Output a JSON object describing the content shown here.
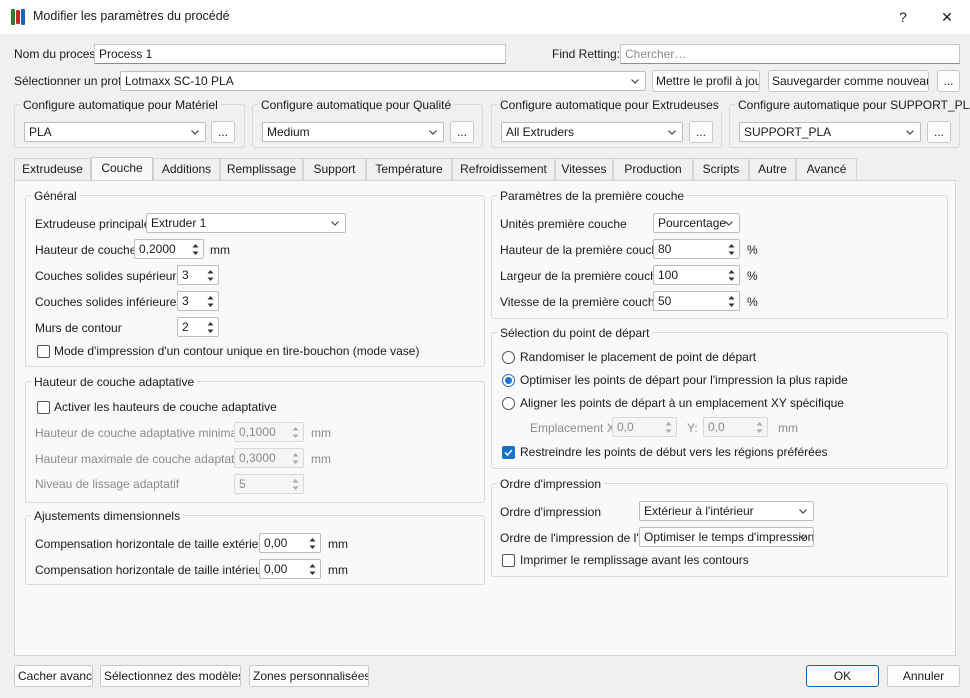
{
  "window": {
    "title": "Modifier les paramètres du procédé",
    "help_label": "?",
    "close_label": "✕"
  },
  "process_name": {
    "label": "Nom du process",
    "value": "Process 1"
  },
  "find_setting": {
    "label": "Find Retting:",
    "placeholder": "Chercher…"
  },
  "profile": {
    "label": "Sélectionner un profil",
    "value": "Lotmaxx SC-10 PLA",
    "update_button": "Mettre le profil à jour",
    "save_new_button": "Sauvegarder comme nouveau…",
    "more_button": "..."
  },
  "auto_config": [
    {
      "title": "Configure automatique pour Matériel",
      "value": "PLA",
      "more": "..."
    },
    {
      "title": "Configure automatique pour Qualité",
      "value": "Medium",
      "more": "..."
    },
    {
      "title": "Configure automatique pour Extrudeuses",
      "value": "All Extruders",
      "more": "..."
    },
    {
      "title": "Configure automatique pour SUPPORT_PLA",
      "value": "SUPPORT_PLA",
      "more": "..."
    }
  ],
  "tabs": [
    "Extrudeuse",
    "Couche",
    "Additions",
    "Remplissage",
    "Support",
    "Température",
    "Refroidissement",
    "Vitesses",
    "Production",
    "Scripts",
    "Autre",
    "Avancé"
  ],
  "active_tab": "Couche",
  "general": {
    "title": "Général",
    "main_extruder_label": "Extrudeuse principale",
    "main_extruder_value": "Extruder 1",
    "layer_height_label": "Hauteur de couche",
    "layer_height_value": "0,2000",
    "layer_height_unit": "mm",
    "top_solid_label": "Couches solides supérieures",
    "top_solid_value": "3",
    "bottom_solid_label": "Couches solides inférieures",
    "bottom_solid_value": "3",
    "perimeters_label": "Murs de contour",
    "perimeters_value": "2",
    "vase_mode_label": "Mode d'impression d'un contour unique en tire-bouchon (mode vase)",
    "vase_mode_checked": false
  },
  "adaptive": {
    "title": "Hauteur de couche adaptative",
    "enable_label": "Activer les hauteurs de couche adaptative",
    "enable_checked": false,
    "min_label": "Hauteur de couche adaptative minimale",
    "min_value": "0,1000",
    "min_unit": "mm",
    "max_label": "Hauteur maximale de couche adaptative",
    "max_value": "0,3000",
    "max_unit": "mm",
    "smooth_label": "Niveau de lissage adaptatif",
    "smooth_value": "5"
  },
  "dimensional": {
    "title": "Ajustements dimensionnels",
    "outer_label": "Compensation horizontale de taille extérieure",
    "outer_value": "0,00",
    "outer_unit": "mm",
    "inner_label": "Compensation horizontale de taille intérieure",
    "inner_value": "0,00",
    "inner_unit": "mm"
  },
  "first_layer": {
    "title": "Paramètres de la première couche",
    "units_label": "Unités première couche",
    "units_value": "Pourcentage",
    "height_label": "Hauteur de la première couche",
    "height_value": "80",
    "width_label": "Largeur de la première couche",
    "width_value": "100",
    "speed_label": "Vitesse de la première couche",
    "speed_value": "50",
    "percent": "%"
  },
  "start_point": {
    "title": "Sélection du point de départ",
    "options": [
      "Randomiser le placement de point de départ",
      "Optimiser les points de départ pour l'impression la plus rapide",
      "Aligner les points de départ à un emplacement XY spécifique"
    ],
    "selected_index": 1,
    "location_x_label": "Emplacement X:",
    "location_x_value": "0,0",
    "location_y_label": "Y:",
    "location_y_value": "0,0",
    "location_unit": "mm",
    "restrict_label": "Restreindre les points de début vers les régions préférées",
    "restrict_checked": true
  },
  "print_order": {
    "title": "Ordre d'impression",
    "order_label": "Ordre d'impression",
    "order_value": "Extérieur à l'intérieur",
    "island_label": "Ordre de l'impression de l'île",
    "island_value": "Optimiser le temps d'impression",
    "infill_first_label": "Imprimer le remplissage avant les contours",
    "infill_first_checked": false
  },
  "footer": {
    "hide_advanced": "Cacher avancé",
    "select_models": "Sélectionnez des modèles…",
    "custom_zones": "Zones personnalisées…",
    "ok": "OK",
    "cancel": "Annuler"
  },
  "colors": {
    "accent": "#1a6fd0",
    "ok_border": "#0a62c4"
  }
}
